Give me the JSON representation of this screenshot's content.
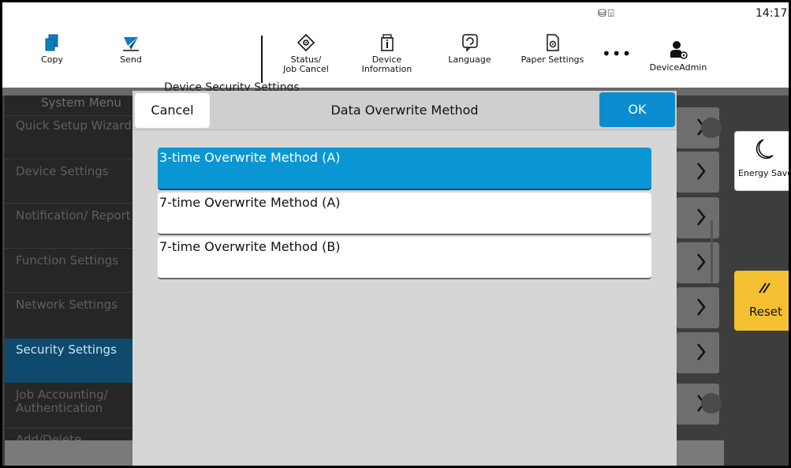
{
  "statusbar": {
    "icons": "⛁⌹",
    "time": "14:17"
  },
  "toolbar": {
    "copy": "Copy",
    "send": "Send",
    "status_line1": "Status/",
    "status_line2": "Job Cancel",
    "device_line1": "Device",
    "device_line2": "Information",
    "language": "Language",
    "paper_settings": "Paper Settings",
    "more": "•••",
    "device_admin": "DeviceAdmin"
  },
  "background": {
    "page_header": "Device Security Settings",
    "sidebar_title": "System Menu",
    "sidebar_items": [
      "Quick Setup Wizard",
      "Device Settings",
      "Notification/ Report",
      "Function Settings",
      "Network Settings",
      "Security Settings",
      "Job Accounting/ Authentication",
      "Add/Delete"
    ],
    "active_item": "Security Settings"
  },
  "side_buttons": {
    "energy_saver": "Energy Saver",
    "reset": "Reset"
  },
  "dialog": {
    "cancel": "Cancel",
    "title": "Data Overwrite Method",
    "ok": "OK",
    "options": [
      {
        "label": "3-time Overwrite Method (A)",
        "selected": true
      },
      {
        "label": "7-time Overwrite Method (A)",
        "selected": false
      },
      {
        "label": "7-time Overwrite Method (B)",
        "selected": false
      }
    ]
  },
  "colors": {
    "accent": "#0a96d2",
    "reset": "#f5c031",
    "sidebar_active": "#0d4a6b"
  }
}
